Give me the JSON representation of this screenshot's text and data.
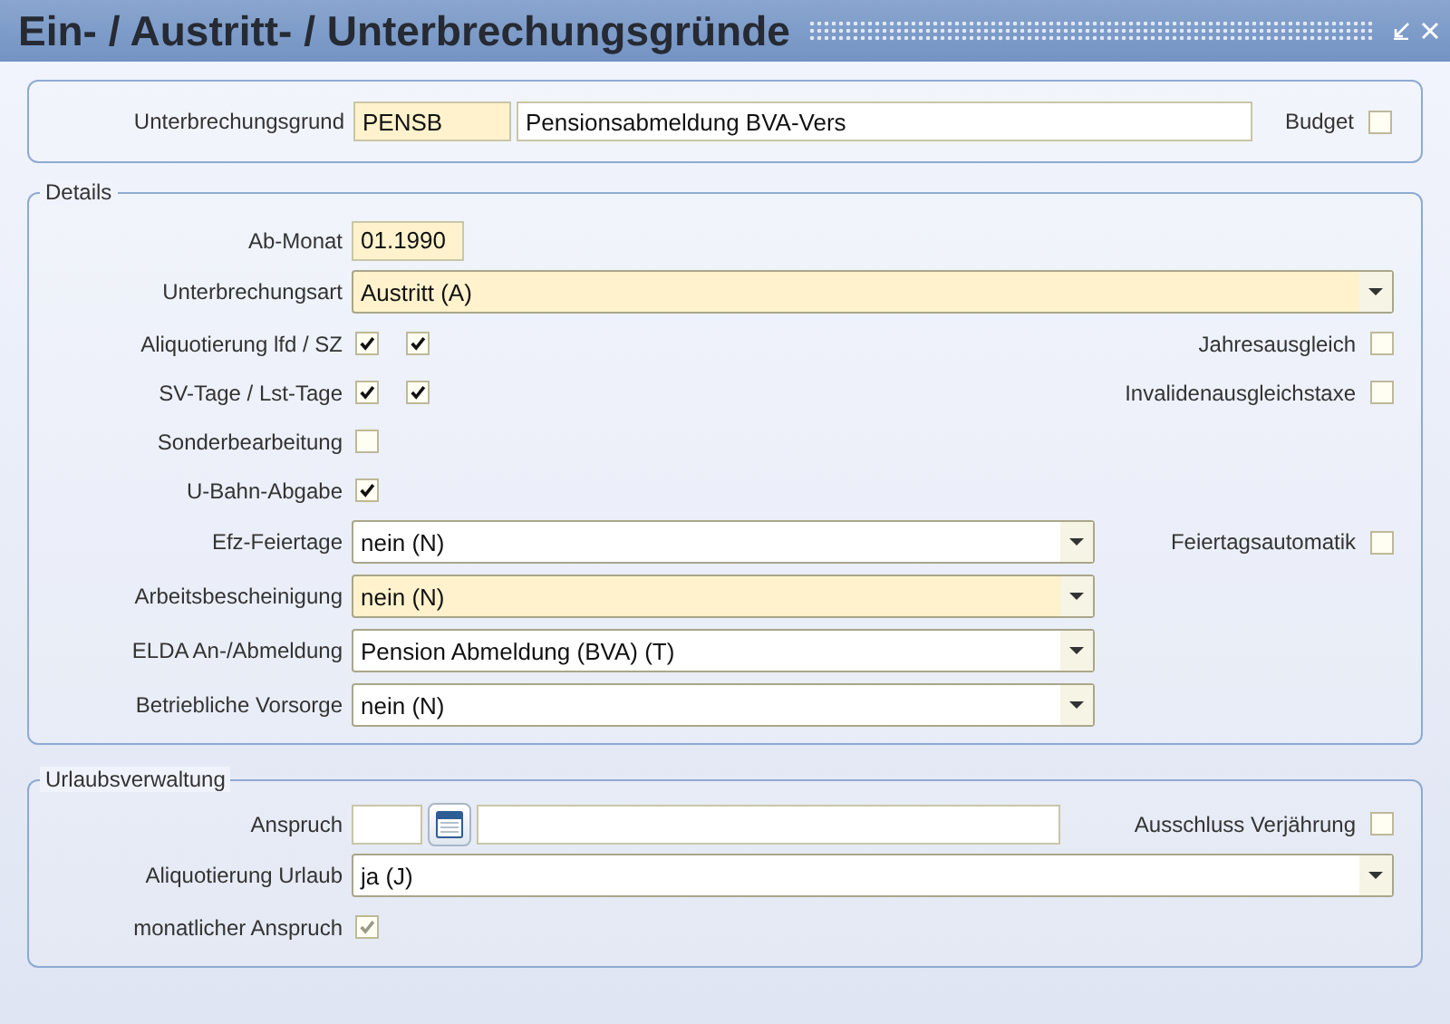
{
  "window": {
    "title": "Ein- / Austritt- / Unterbrechungsgründe"
  },
  "header": {
    "label": "Unterbrechungsgrund",
    "code": "PENSB",
    "description": "Pensionsabmeldung BVA-Vers",
    "budget": {
      "label": "Budget",
      "checked": false
    }
  },
  "details": {
    "legend": "Details",
    "rows": [
      {
        "kind": "input",
        "label": "Ab-Monat",
        "value": "01.1990",
        "required": true
      },
      {
        "kind": "select",
        "label": "Unterbrechungsart",
        "value": "Austritt (A)",
        "required": true,
        "wide": true
      },
      {
        "kind": "checks",
        "label": "Aliquotierung lfd / SZ",
        "checks": [
          {
            "checked": true
          },
          {
            "checked": true
          }
        ],
        "right": {
          "label": "Jahresausgleich",
          "checked": false
        }
      },
      {
        "kind": "checks",
        "label": "SV-Tage / Lst-Tage",
        "checks": [
          {
            "checked": true
          },
          {
            "checked": true
          }
        ],
        "right": {
          "label": "Invalidenausgleichstaxe",
          "checked": false
        }
      },
      {
        "kind": "checks",
        "label": "Sonderbearbeitung",
        "checks": [
          {
            "checked": false
          }
        ]
      },
      {
        "kind": "checks",
        "label": "U-Bahn-Abgabe",
        "checks": [
          {
            "checked": true
          }
        ]
      },
      {
        "kind": "select",
        "label": "Efz-Feiertage",
        "value": "nein (N)",
        "required": false,
        "wide": false,
        "right": {
          "label": "Feiertagsautomatik",
          "checked": false
        }
      },
      {
        "kind": "select",
        "label": "Arbeitsbescheinigung",
        "value": "nein (N)",
        "required": true,
        "wide": false
      },
      {
        "kind": "select",
        "label": "ELDA An-/Abmeldung",
        "value": "Pension Abmeldung (BVA) (T)",
        "required": false,
        "wide": false
      },
      {
        "kind": "select",
        "label": "Betriebliche Vorsorge",
        "value": "nein (N)",
        "required": false,
        "wide": false
      }
    ]
  },
  "vacation": {
    "legend": "Urlaubsverwaltung",
    "rows": [
      {
        "kind": "amount",
        "label": "Anspruch",
        "right": {
          "label": "Ausschluss Verjährung",
          "checked": false
        }
      },
      {
        "kind": "select",
        "label": "Aliquotierung Urlaub",
        "value": "ja (J)",
        "required": false,
        "wide": true
      },
      {
        "kind": "checks",
        "label": "monatlicher Anspruch",
        "checks": [
          {
            "checked": true,
            "disabled": true
          }
        ]
      }
    ]
  }
}
